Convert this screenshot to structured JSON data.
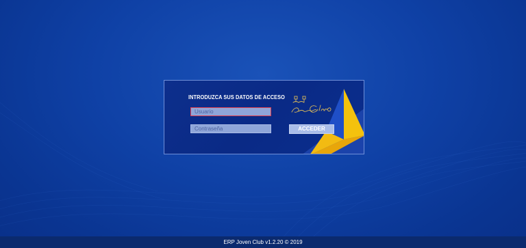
{
  "login": {
    "title": "INTRODUZCA SUS DATOS DE ACCESO",
    "username_placeholder": "Usuario",
    "password_placeholder": "Contraseña",
    "submit_label": "ACCEDER",
    "logo_text": "Joven Club"
  },
  "footer": {
    "text": "ERP Joven Club v1.2.20 © 2019"
  },
  "colors": {
    "background": "#0f41a6",
    "panel": "#0a2a86",
    "accent_yellow": "#f4c20d",
    "accent_orange": "#e8a60a",
    "input_bg": "#8fa6d9",
    "button_bg": "#a9bde9",
    "focus_border": "#e0404f"
  }
}
